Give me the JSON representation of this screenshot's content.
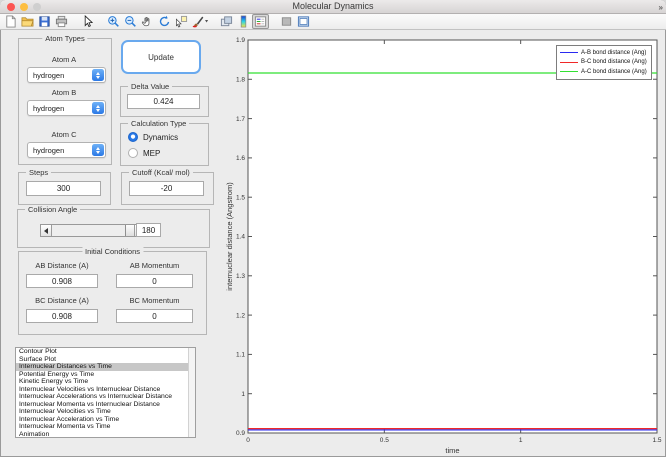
{
  "window": {
    "title": "Molecular Dynamics"
  },
  "titlebar": {
    "close_color": "#fc5552",
    "minimize_color": "#fdbe40",
    "zoom_color": "#cfcfcf"
  },
  "toolbar": {
    "groups": [
      [
        "new-file",
        "open-file",
        "save",
        "print"
      ],
      [
        "pointer"
      ],
      [
        "zoom-in",
        "zoom-out",
        "pan",
        "rotate-3d",
        "data-cursor",
        "brush"
      ],
      [
        "link-plots",
        "insert-colorbar",
        "insert-legend"
      ],
      [
        "hide-plot-tools",
        "show-plot-tools"
      ]
    ],
    "selected": "insert-legend",
    "overflow": "»"
  },
  "panels": {
    "atom_types": {
      "title": "Atom Types",
      "fields": [
        {
          "label": "Atom A",
          "value": "hydrogen"
        },
        {
          "label": "Atom B",
          "value": "hydrogen"
        },
        {
          "label": "Atom C",
          "value": "hydrogen"
        }
      ]
    },
    "update_label": "Update",
    "delta": {
      "title": "Delta Value",
      "value": "0.424"
    },
    "calc_type": {
      "title": "Calculation Type",
      "options": [
        {
          "label": "Dynamics",
          "selected": true
        },
        {
          "label": "MEP",
          "selected": false
        }
      ]
    },
    "steps": {
      "title": "Steps",
      "value": "300"
    },
    "cutoff": {
      "title": "Cutoff (Kcal/ mol)",
      "value": "-20"
    },
    "collision": {
      "title": "Collision Angle",
      "value": "180"
    },
    "initial": {
      "title": "Initial Conditions",
      "fields": [
        {
          "label": "AB Distance (A)",
          "value": "0.908"
        },
        {
          "label": "AB Momentum",
          "value": "0"
        },
        {
          "label": "BC Distance (A)",
          "value": "0.908"
        },
        {
          "label": "BC Momentum",
          "value": "0"
        }
      ]
    },
    "plot_list": {
      "selected_index": 2,
      "items": [
        "Contour Plot",
        "Surface Plot",
        "Internuclear Distances vs Time",
        "Potential Energy vs Time",
        "Kinetic Energy vs Time",
        "Internuclear Velocities vs Internuclear Distance",
        "Internuclear Accelerations vs Internuclear Distance",
        "Internuclear Momenta vs Internuclear Distance",
        "Internuclear Velocities vs Time",
        "Internuclear Acceleration vs Time",
        "Internuclear Momenta vs Time",
        "Animation"
      ]
    }
  },
  "chart_data": {
    "type": "line",
    "title": "",
    "xlabel": "time",
    "ylabel": "internuclear distance (Angstrom)",
    "xlim": [
      0,
      1.5
    ],
    "ylim": [
      0.9,
      1.9
    ],
    "grid": false,
    "legend_position": "upper right",
    "xticks": {
      "values": [
        0,
        0.5,
        1,
        1.5
      ],
      "labels": [
        "0",
        "0.5",
        "1",
        "1.5"
      ]
    },
    "yticks": {
      "values": [
        0.9,
        1.0,
        1.1,
        1.2,
        1.3,
        1.4,
        1.5,
        1.6,
        1.7,
        1.8,
        1.9
      ],
      "labels": [
        "0.9",
        "1",
        "1.1",
        "1.2",
        "1.3",
        "1.4",
        "1.5",
        "1.6",
        "1.7",
        "1.8",
        "1.9"
      ]
    },
    "series": [
      {
        "name": "A-B bond distance (Ang)",
        "color": "#2a2af0",
        "x": [
          0,
          1.5
        ],
        "y": [
          0.908,
          0.908
        ]
      },
      {
        "name": "B-C bond distance (Ang)",
        "color": "#f02828",
        "x": [
          0,
          1.5
        ],
        "y": [
          0.908,
          0.908
        ]
      },
      {
        "name": "A-C bond distance (Ang)",
        "color": "#32e032",
        "x": [
          0,
          1.5
        ],
        "y": [
          1.816,
          1.816
        ]
      }
    ]
  }
}
